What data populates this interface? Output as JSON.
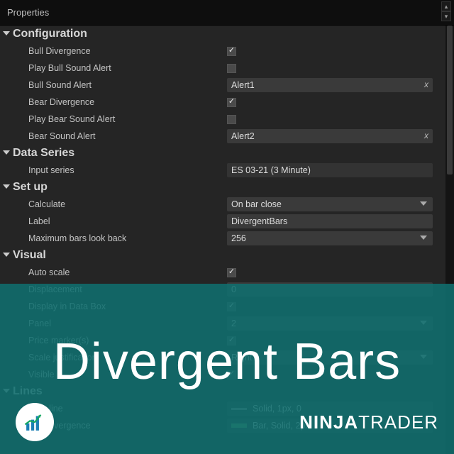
{
  "window": {
    "title": "Properties"
  },
  "overlay": {
    "title": "Divergent Bars",
    "brand_bold": "NINJA",
    "brand_thin": "TRADER"
  },
  "sections": {
    "configuration": {
      "header": "Configuration",
      "bull_divergence": {
        "label": "Bull Divergence",
        "checked": true
      },
      "play_bull_sound": {
        "label": "Play Bull Sound Alert",
        "checked": false
      },
      "bull_sound_alert": {
        "label": "Bull Sound Alert",
        "value": "Alert1"
      },
      "bear_divergence": {
        "label": "Bear Divergence",
        "checked": true
      },
      "play_bear_sound": {
        "label": "Play Bear Sound Alert",
        "checked": false
      },
      "bear_sound_alert": {
        "label": "Bear Sound Alert",
        "value": "Alert2"
      }
    },
    "data_series": {
      "header": "Data Series",
      "input_series": {
        "label": "Input series",
        "value": "ES 03-21 (3 Minute)"
      }
    },
    "setup": {
      "header": "Set up",
      "calculate": {
        "label": "Calculate",
        "value": "On bar close"
      },
      "label_field": {
        "label": "Label",
        "value": "DivergentBars"
      },
      "max_bars": {
        "label": "Maximum bars look back",
        "value": "256"
      }
    },
    "visual": {
      "header": "Visual",
      "auto_scale": {
        "label": "Auto scale",
        "checked": true
      },
      "displacement": {
        "label": "Displacement",
        "value": "0"
      },
      "display_databox": {
        "label": "Display in Data Box",
        "checked": true
      },
      "panel": {
        "label": "Panel",
        "value": "2"
      },
      "price_marker": {
        "label": "Price marker(s)",
        "checked": true
      },
      "scale_justification": {
        "label": "Scale justification",
        "value": "Right"
      },
      "visible": {
        "label": "Visible",
        "checked": true
      }
    },
    "lines": {
      "header": "Lines",
      "zero_line": {
        "label": "Zero line",
        "value": "Solid, 1px, 0"
      },
      "bull_divergence": {
        "label": "Bull Divergence",
        "value": "Bar, Solid, 2px"
      }
    }
  }
}
